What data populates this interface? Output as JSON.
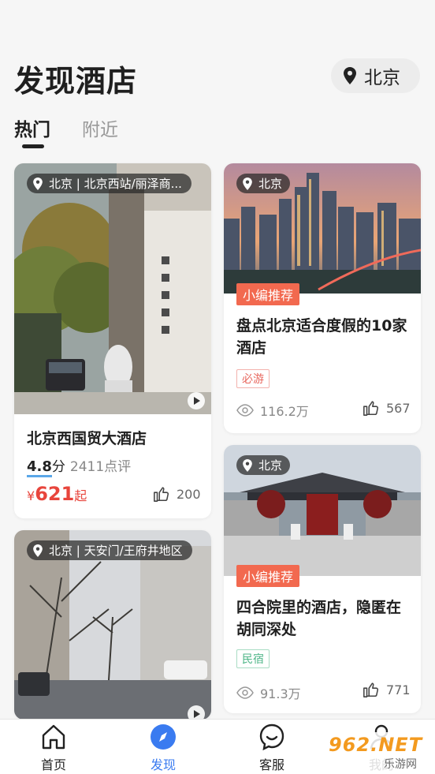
{
  "header": {
    "title": "发现酒店",
    "city": "北京"
  },
  "tabs": [
    {
      "label": "热门",
      "active": true
    },
    {
      "label": "附近",
      "active": false
    }
  ],
  "cards": [
    {
      "id": "c1",
      "location": "北京 | 北京西站/丽泽商...",
      "name": "北京西国贸大酒店",
      "rating": "4.8",
      "rating_unit": "分",
      "reviews": "2411点评",
      "price_symbol": "¥",
      "price": "621",
      "price_suffix": "起",
      "likes": "200",
      "has_video": true
    },
    {
      "id": "c2",
      "location": "北京",
      "badge": "小编推荐",
      "title": "盘点北京适合度假的10家酒店",
      "tag": "必游",
      "views": "116.2万",
      "likes": "567"
    },
    {
      "id": "c3",
      "location": "北京",
      "badge": "小编推荐",
      "title": "四合院里的酒店，隐匿在胡同深处",
      "tag": "民宿",
      "views": "91.3万",
      "likes": "771"
    },
    {
      "id": "c4",
      "location": "北京 | 天安门/王府井地区",
      "has_video": true
    }
  ],
  "bottom_nav": [
    {
      "label": "首页",
      "icon": "home-icon",
      "active": false
    },
    {
      "label": "发现",
      "icon": "compass-icon",
      "active": true
    },
    {
      "label": "客服",
      "icon": "chat-icon",
      "active": false
    },
    {
      "label": "我的",
      "icon": "user-icon",
      "active": false
    }
  ],
  "watermark": {
    "text": "962.NET",
    "subtext": "乐游网"
  },
  "colors": {
    "accent": "#3a7bf0",
    "price": "#e8453c",
    "badge": "#f2694f"
  }
}
